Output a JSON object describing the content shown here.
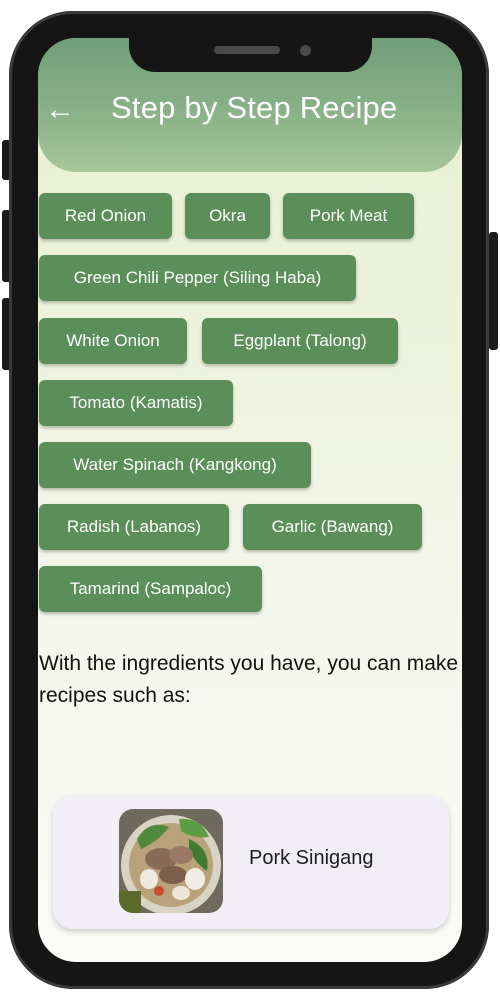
{
  "header": {
    "title": "Step by Step Recipe",
    "back_icon": "←"
  },
  "ingredients": [
    "Red Onion",
    "Okra",
    "Pork Meat",
    "Green Chili Pepper (Siling Haba)",
    "White Onion",
    "Eggplant (Talong)",
    "Tomato (Kamatis)",
    "Water Spinach (Kangkong)",
    "Radish (Labanos)",
    "Garlic (Bawang)",
    "Tamarind (Sampaloc)"
  ],
  "intro_text": "With the ingredients you have, you can make recipes such as:",
  "recipes": [
    {
      "name": "Pork Sinigang",
      "image": "pork-sinigang-bowl"
    }
  ],
  "colors": {
    "header": "#7aa57e",
    "chip": "#5a8f5a",
    "card": "#f1eef5"
  }
}
